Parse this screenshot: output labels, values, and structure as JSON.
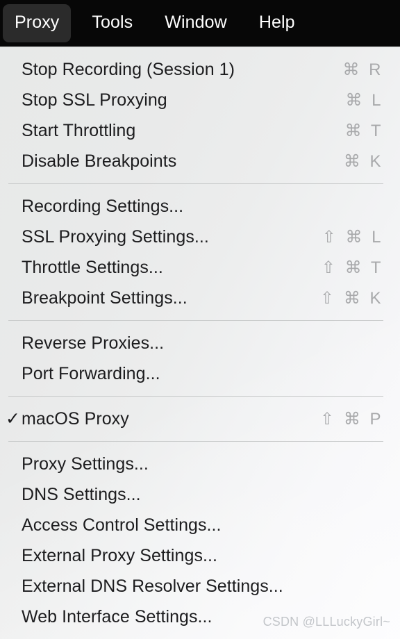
{
  "menubar": {
    "items": [
      {
        "label": "Proxy",
        "active": true
      },
      {
        "label": "Tools",
        "active": false
      },
      {
        "label": "Window",
        "active": false
      },
      {
        "label": "Help",
        "active": false
      }
    ]
  },
  "menu": {
    "groups": [
      {
        "items": [
          {
            "label": "Stop Recording (Session 1)",
            "shortcut": "⌘ R",
            "checked": false
          },
          {
            "label": "Stop SSL Proxying",
            "shortcut": "⌘ L",
            "checked": false
          },
          {
            "label": "Start Throttling",
            "shortcut": "⌘ T",
            "checked": false
          },
          {
            "label": "Disable Breakpoints",
            "shortcut": "⌘ K",
            "checked": false
          }
        ]
      },
      {
        "items": [
          {
            "label": "Recording Settings...",
            "shortcut": "",
            "checked": false
          },
          {
            "label": "SSL Proxying Settings...",
            "shortcut": "⇧ ⌘ L",
            "checked": false
          },
          {
            "label": "Throttle Settings...",
            "shortcut": "⇧ ⌘ T",
            "checked": false
          },
          {
            "label": "Breakpoint Settings...",
            "shortcut": "⇧ ⌘ K",
            "checked": false
          }
        ]
      },
      {
        "items": [
          {
            "label": "Reverse Proxies...",
            "shortcut": "",
            "checked": false
          },
          {
            "label": "Port Forwarding...",
            "shortcut": "",
            "checked": false
          }
        ]
      },
      {
        "items": [
          {
            "label": "macOS Proxy",
            "shortcut": "⇧ ⌘ P",
            "checked": true
          }
        ]
      },
      {
        "items": [
          {
            "label": "Proxy Settings...",
            "shortcut": "",
            "checked": false
          },
          {
            "label": "DNS Settings...",
            "shortcut": "",
            "checked": false
          },
          {
            "label": "Access Control Settings...",
            "shortcut": "",
            "checked": false
          },
          {
            "label": "External Proxy Settings...",
            "shortcut": "",
            "checked": false
          },
          {
            "label": "External DNS Resolver Settings...",
            "shortcut": "",
            "checked": false
          },
          {
            "label": "Web Interface Settings...",
            "shortcut": "",
            "checked": false
          }
        ]
      }
    ],
    "check_glyph": "✓"
  },
  "watermark": {
    "text": "CSDN @LLLuckyGirl~"
  },
  "colors": {
    "menubar_bg": "#070707",
    "menubar_active_bg": "#2b2b2b",
    "menubar_text": "#ffffff",
    "panel_bg": "#e9eaea",
    "item_text": "#1c1c1e",
    "shortcut_text": "#a8a9ab",
    "separator": "#c9cbcb",
    "watermark_text": "#c3c6ca"
  }
}
